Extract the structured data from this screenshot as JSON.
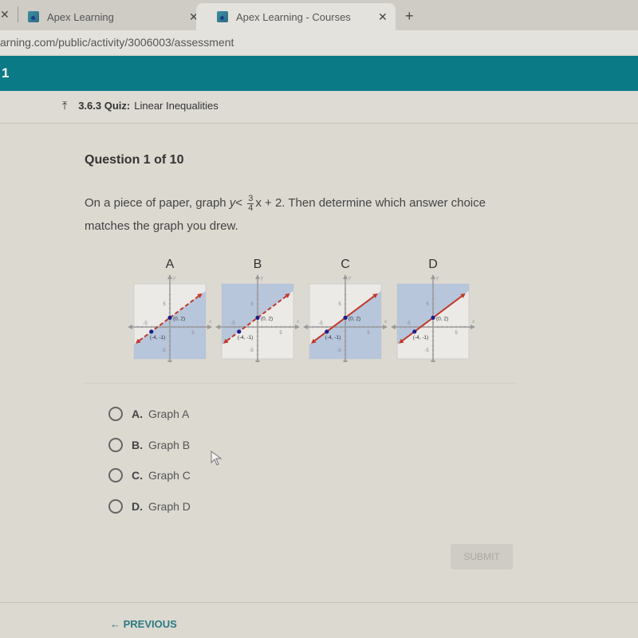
{
  "browser": {
    "tabs": [
      {
        "title": "Apex Learning",
        "active": false
      },
      {
        "title": "Apex Learning - Courses",
        "active": true
      }
    ],
    "new_tab_icon": "+",
    "url": "arning.com/public/activity/3006003/assessment"
  },
  "header": {
    "bar_text": "1",
    "breadcrumb": {
      "icon": "up-arrow-icon",
      "section": "3.6.3 Quiz:",
      "title": "Linear Inequalities"
    }
  },
  "question": {
    "counter": "Question 1 of 10",
    "text_before": "On a piece of paper, graph ",
    "inequality": {
      "lhs": "y",
      "op": "<",
      "num": "3",
      "den": "4",
      "rest": "x + 2"
    },
    "text_after": ". Then determine which answer choice matches the graph you drew."
  },
  "graphs": [
    {
      "label": "A",
      "line": "dashed",
      "shade": "below"
    },
    {
      "label": "B",
      "line": "dashed",
      "shade": "above"
    },
    {
      "label": "C",
      "line": "solid",
      "shade": "below"
    },
    {
      "label": "D",
      "line": "solid",
      "shade": "above"
    }
  ],
  "graph_common": {
    "points": [
      {
        "x": 0,
        "y": 2,
        "label": "(0, 2)"
      },
      {
        "x": -4,
        "y": -1,
        "label": "(-4, -1)"
      }
    ],
    "tick_labels": {
      "x_pos": "5",
      "x_neg": "-5",
      "y_pos": "5",
      "y_neg": "-5"
    },
    "axis_x": "x",
    "axis_y": "y",
    "range": [
      -7,
      7
    ]
  },
  "options": [
    {
      "letter": "A.",
      "text": "Graph A"
    },
    {
      "letter": "B.",
      "text": "Graph B"
    },
    {
      "letter": "C.",
      "text": "Graph C"
    },
    {
      "letter": "D.",
      "text": "Graph D"
    }
  ],
  "buttons": {
    "submit": "SUBMIT",
    "previous": "PREVIOUS"
  },
  "colors": {
    "teal": "#0b7a87",
    "shade": "#aebfd8",
    "line": "#c0392b",
    "point": "#1a1f8a"
  }
}
